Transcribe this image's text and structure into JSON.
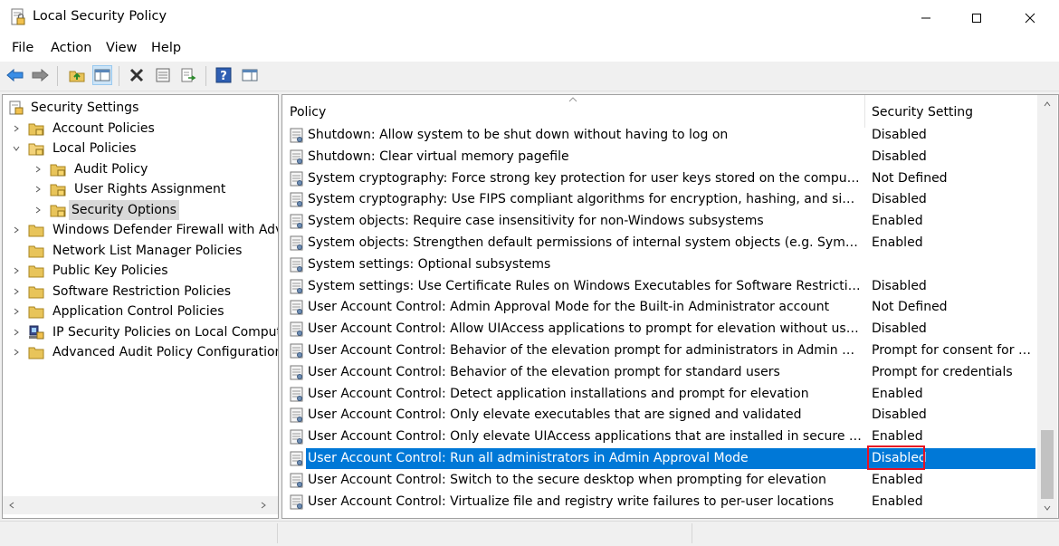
{
  "window": {
    "title": "Local Security Policy"
  },
  "menu": [
    {
      "id": "file",
      "label": "File"
    },
    {
      "id": "action",
      "label": "Action"
    },
    {
      "id": "view",
      "label": "View"
    },
    {
      "id": "help",
      "label": "Help"
    }
  ],
  "toolbar": [
    "back-arrow-icon",
    "forward-arrow-icon",
    "up-folder-icon",
    "show-hide-tree-icon",
    "delete-icon",
    "properties-icon",
    "export-list-icon",
    "help-icon",
    "show-hide-action-pane-icon"
  ],
  "tree": {
    "root": "Security Settings",
    "items": [
      {
        "label": "Account Policies"
      },
      {
        "label": "Local Policies"
      },
      {
        "label": "Audit Policy"
      },
      {
        "label": "User Rights Assignment"
      },
      {
        "label": "Security Options"
      },
      {
        "label": "Windows Defender Firewall with Advar"
      },
      {
        "label": "Network List Manager Policies"
      },
      {
        "label": "Public Key Policies"
      },
      {
        "label": "Software Restriction Policies"
      },
      {
        "label": "Application Control Policies"
      },
      {
        "label": "IP Security Policies on Local Computer"
      },
      {
        "label": "Advanced Audit Policy Configuration"
      }
    ]
  },
  "list": {
    "columns": {
      "policy": "Policy",
      "setting": "Security Setting"
    },
    "rows": [
      {
        "policy": "Shutdown: Allow system to be shut down without having to log on",
        "setting": "Disabled"
      },
      {
        "policy": "Shutdown: Clear virtual memory pagefile",
        "setting": "Disabled"
      },
      {
        "policy": "System cryptography: Force strong key protection for user keys stored on the computer",
        "setting": "Not Defined"
      },
      {
        "policy": "System cryptography: Use FIPS compliant algorithms for encryption, hashing, and signing",
        "setting": "Disabled"
      },
      {
        "policy": "System objects: Require case insensitivity for non-Windows subsystems",
        "setting": "Enabled"
      },
      {
        "policy": "System objects: Strengthen default permissions of internal system objects (e.g. Symbolic Links)",
        "setting": "Enabled"
      },
      {
        "policy": "System settings: Optional subsystems",
        "setting": ""
      },
      {
        "policy": "System settings: Use Certificate Rules on Windows Executables for Software Restriction Policies",
        "setting": "Disabled"
      },
      {
        "policy": "User Account Control: Admin Approval Mode for the Built-in Administrator account",
        "setting": "Not Defined"
      },
      {
        "policy": "User Account Control: Allow UIAccess applications to prompt for elevation without using the ...",
        "setting": "Disabled"
      },
      {
        "policy": "User Account Control: Behavior of the elevation prompt for administrators in Admin Approva...",
        "setting": "Prompt for consent for n..."
      },
      {
        "policy": "User Account Control: Behavior of the elevation prompt for standard users",
        "setting": "Prompt for credentials"
      },
      {
        "policy": "User Account Control: Detect application installations and prompt for elevation",
        "setting": "Enabled"
      },
      {
        "policy": "User Account Control: Only elevate executables that are signed and validated",
        "setting": "Disabled"
      },
      {
        "policy": "User Account Control: Only elevate UIAccess applications that are installed in secure locations",
        "setting": "Enabled"
      },
      {
        "policy": "User Account Control: Run all administrators in Admin Approval Mode",
        "setting": "Disabled"
      },
      {
        "policy": "User Account Control: Switch to the secure desktop when prompting for elevation",
        "setting": "Enabled"
      },
      {
        "policy": "User Account Control: Virtualize file and registry write failures to per-user locations",
        "setting": "Enabled"
      }
    ]
  },
  "colors": {
    "selection": "#0078d7",
    "highlight_box": "#e81123",
    "tree_selection": "#d9d9d9"
  }
}
